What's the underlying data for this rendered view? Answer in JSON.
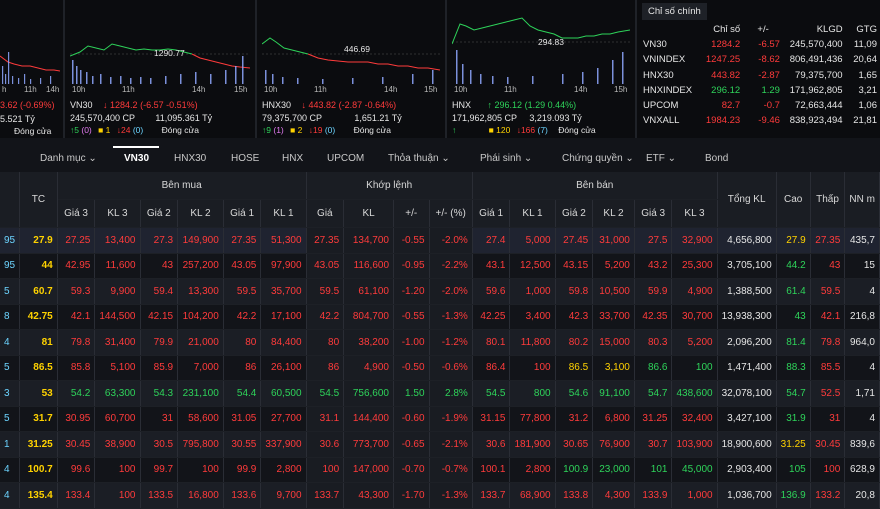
{
  "minis": [
    {
      "id": "m0",
      "peak": "",
      "times": [
        "",
        "",
        "",
        ""
      ],
      "name": "",
      "price": "",
      "change": "3.62 (-0.69%)",
      "color": "dn",
      "vol": "5.521 Tỷ",
      "up": "",
      "ce": "",
      "dn": "",
      "status": "Đóng cửa"
    },
    {
      "id": "m1",
      "peak": "1290.77",
      "times": [
        "10h",
        "11h",
        "14h",
        "15h"
      ],
      "name": "VN30",
      "price": "↓ 1284.2",
      "change": "(-6.57 -0.51%)",
      "color": "dn",
      "vol": "245,570,400 CP",
      "val": "11,095.361 Tỷ",
      "up": "↑5",
      "ce": "(0)",
      "fl": "■ 1",
      "dn": "↓24",
      "dn2": "(0)",
      "status": "Đóng cửa"
    },
    {
      "id": "m2",
      "peak": "446.69",
      "times": [
        "10h",
        "11h",
        "14h",
        "15h"
      ],
      "name": "HNX30",
      "price": "↓ 443.82",
      "change": "(-2.87 -0.64%)",
      "color": "dn",
      "vol": "79,375,700 CP",
      "val": "1,651.21 Tỷ",
      "up": "↑9",
      "ce": "(1)",
      "fl": "■ 2",
      "dn": "↓19",
      "dn2": "(0)",
      "status": "Đóng cửa"
    },
    {
      "id": "m3",
      "peak": "294.83",
      "times": [
        "10h",
        "11h",
        "14h",
        "15h"
      ],
      "name": "HNX",
      "price": "↑ 296.12",
      "change": "(1.29 0.44%)",
      "color": "up",
      "vol": "171,962,805 CP",
      "val": "3,219.093 Tỷ",
      "up": "↑",
      "ce": "",
      "fl": "■ 120",
      "dn": "↓166",
      "dn2": "(7)",
      "status": "Đóng cửa"
    }
  ],
  "index_panel": {
    "tab": "Chỉ số chính",
    "headers": [
      "Chỉ số",
      "+/-",
      "KLGD",
      "GTG"
    ],
    "rows": [
      {
        "name": "VN30",
        "value": "1284.2",
        "change": "-6.57",
        "vol": "245,570,400",
        "gtg": "11,09",
        "c": "dn"
      },
      {
        "name": "VNINDEX",
        "value": "1247.25",
        "change": "-8.62",
        "vol": "806,491,436",
        "gtg": "20,64",
        "c": "dn"
      },
      {
        "name": "HNX30",
        "value": "443.82",
        "change": "-2.87",
        "vol": "79,375,700",
        "gtg": "1,65",
        "c": "dn"
      },
      {
        "name": "HNXINDEX",
        "value": "296.12",
        "change": "1.29",
        "vol": "171,962,805",
        "gtg": "3,21",
        "c": "up"
      },
      {
        "name": "UPCOM",
        "value": "82.7",
        "change": "-0.7",
        "vol": "72,663,444",
        "gtg": "1,06",
        "c": "dn"
      },
      {
        "name": "VNXALL",
        "value": "1984.23",
        "change": "-9.46",
        "vol": "838,923,494",
        "gtg": "21,81",
        "c": "dn"
      }
    ]
  },
  "tabs": [
    "Danh mục ⌄",
    "VN30",
    "HNX30",
    "HOSE",
    "HNX",
    "UPCOM",
    "Thỏa thuận ⌄",
    "Phái sinh ⌄",
    "Chứng quyền ⌄",
    "ETF ⌄",
    "Bond"
  ],
  "groups": {
    "buy": "Bên mua",
    "match": "Khớp lệnh",
    "sell": "Bên bán"
  },
  "columns": [
    "TC",
    "Giá 3",
    "KL 3",
    "Giá 2",
    "KL 2",
    "Giá 1",
    "KL 1",
    "Giá",
    "KL",
    "+/-",
    "+/- (%)",
    "Giá 1",
    "KL 1",
    "Giá 2",
    "KL 2",
    "Giá 3",
    "KL 3",
    "Tổng KL",
    "Cao",
    "Thấp",
    "NN m"
  ],
  "rows": [
    {
      "s": "95",
      "c": [
        "27.9",
        "27.25",
        "13,400",
        "27.3",
        "149,900",
        "27.35",
        "51,300",
        "27.35",
        "134,700",
        "-0.55",
        "-2.0%",
        "27.4",
        "5,000",
        "27.45",
        "31,000",
        "27.5",
        "32,900",
        "4,656,800",
        "27.9",
        "27.35",
        "435,7"
      ],
      "k": [
        "ce",
        "dn",
        "dn",
        "dn",
        "dn",
        "dn",
        "dn",
        "dn",
        "dn",
        "dn",
        "dn",
        "dn",
        "dn",
        "dn",
        "dn",
        "dn",
        "dn",
        "wh",
        "ce",
        "dn",
        "wh"
      ]
    },
    {
      "s": "95",
      "c": [
        "44",
        "42.95",
        "11,600",
        "43",
        "257,200",
        "43.05",
        "97,900",
        "43.05",
        "116,600",
        "-0.95",
        "-2.2%",
        "43.1",
        "12,500",
        "43.15",
        "5,200",
        "43.2",
        "25,300",
        "3,705,100",
        "44.2",
        "43",
        "15"
      ],
      "k": [
        "ce",
        "dn",
        "dn",
        "dn",
        "dn",
        "dn",
        "dn",
        "dn",
        "dn",
        "dn",
        "dn",
        "dn",
        "dn",
        "dn",
        "dn",
        "dn",
        "dn",
        "wh",
        "up",
        "dn",
        "wh"
      ]
    },
    {
      "s": "5",
      "c": [
        "60.7",
        "59.3",
        "9,900",
        "59.4",
        "13,300",
        "59.5",
        "35,700",
        "59.5",
        "61,100",
        "-1.20",
        "-2.0%",
        "59.6",
        "1,000",
        "59.8",
        "10,500",
        "59.9",
        "4,900",
        "1,388,500",
        "61.4",
        "59.5",
        "4"
      ],
      "k": [
        "ce",
        "dn",
        "dn",
        "dn",
        "dn",
        "dn",
        "dn",
        "dn",
        "dn",
        "dn",
        "dn",
        "dn",
        "dn",
        "dn",
        "dn",
        "dn",
        "dn",
        "wh",
        "up",
        "dn",
        "wh"
      ]
    },
    {
      "s": "8",
      "c": [
        "42.75",
        "42.1",
        "144,500",
        "42.15",
        "104,200",
        "42.2",
        "17,100",
        "42.2",
        "804,700",
        "-0.55",
        "-1.3%",
        "42.25",
        "3,400",
        "42.3",
        "33,700",
        "42.35",
        "30,700",
        "13,938,300",
        "43",
        "42.1",
        "216,8"
      ],
      "k": [
        "ce",
        "dn",
        "dn",
        "dn",
        "dn",
        "dn",
        "dn",
        "dn",
        "dn",
        "dn",
        "dn",
        "dn",
        "dn",
        "dn",
        "dn",
        "dn",
        "dn",
        "wh",
        "up",
        "dn",
        "wh"
      ]
    },
    {
      "s": "4",
      "c": [
        "81",
        "79.8",
        "31,400",
        "79.9",
        "21,000",
        "80",
        "84,400",
        "80",
        "38,200",
        "-1.00",
        "-1.2%",
        "80.1",
        "11,800",
        "80.2",
        "15,000",
        "80.3",
        "5,200",
        "2,096,200",
        "81.4",
        "79.8",
        "964,0"
      ],
      "k": [
        "ce",
        "dn",
        "dn",
        "dn",
        "dn",
        "dn",
        "dn",
        "dn",
        "dn",
        "dn",
        "dn",
        "dn",
        "dn",
        "dn",
        "dn",
        "dn",
        "dn",
        "wh",
        "up",
        "dn",
        "wh"
      ]
    },
    {
      "s": "5",
      "c": [
        "86.5",
        "85.8",
        "5,100",
        "85.9",
        "7,000",
        "86",
        "26,100",
        "86",
        "4,900",
        "-0.50",
        "-0.6%",
        "86.4",
        "100",
        "86.5",
        "3,100",
        "86.6",
        "100",
        "1,471,400",
        "88.3",
        "85.5",
        "4"
      ],
      "k": [
        "ce",
        "dn",
        "dn",
        "dn",
        "dn",
        "dn",
        "dn",
        "dn",
        "dn",
        "dn",
        "dn",
        "dn",
        "dn",
        "ce",
        "ce",
        "up",
        "up",
        "wh",
        "up",
        "dn",
        "wh"
      ]
    },
    {
      "s": "3",
      "c": [
        "53",
        "54.2",
        "63,300",
        "54.3",
        "231,100",
        "54.4",
        "60,500",
        "54.5",
        "756,600",
        "1.50",
        "2.8%",
        "54.5",
        "800",
        "54.6",
        "91,100",
        "54.7",
        "438,600",
        "32,078,100",
        "54.7",
        "52.5",
        "1,71"
      ],
      "k": [
        "ce",
        "up",
        "up",
        "up",
        "up",
        "up",
        "up",
        "up",
        "up",
        "up",
        "up",
        "up",
        "up",
        "up",
        "up",
        "up",
        "up",
        "wh",
        "up",
        "dn",
        "wh"
      ]
    },
    {
      "s": "5",
      "c": [
        "31.7",
        "30.95",
        "60,700",
        "31",
        "58,600",
        "31.05",
        "27,700",
        "31.1",
        "144,400",
        "-0.60",
        "-1.9%",
        "31.15",
        "77,800",
        "31.2",
        "6,800",
        "31.25",
        "32,400",
        "3,427,100",
        "31.9",
        "31",
        "4"
      ],
      "k": [
        "ce",
        "dn",
        "dn",
        "dn",
        "dn",
        "dn",
        "dn",
        "dn",
        "dn",
        "dn",
        "dn",
        "dn",
        "dn",
        "dn",
        "dn",
        "dn",
        "dn",
        "wh",
        "up",
        "dn",
        "wh"
      ]
    },
    {
      "s": "1",
      "c": [
        "31.25",
        "30.45",
        "38,900",
        "30.5",
        "795,800",
        "30.55",
        "337,900",
        "30.6",
        "773,700",
        "-0.65",
        "-2.1%",
        "30.6",
        "181,900",
        "30.65",
        "76,900",
        "30.7",
        "103,900",
        "18,900,600",
        "31.25",
        "30.45",
        "839,6"
      ],
      "k": [
        "ce",
        "dn",
        "dn",
        "dn",
        "dn",
        "dn",
        "dn",
        "dn",
        "dn",
        "dn",
        "dn",
        "dn",
        "dn",
        "dn",
        "dn",
        "dn",
        "dn",
        "wh",
        "ce",
        "dn",
        "wh"
      ]
    },
    {
      "s": "4",
      "c": [
        "100.7",
        "99.6",
        "100",
        "99.7",
        "100",
        "99.9",
        "2,800",
        "100",
        "147,000",
        "-0.70",
        "-0.7%",
        "100.1",
        "2,800",
        "100.9",
        "23,000",
        "101",
        "45,000",
        "2,903,400",
        "105",
        "100",
        "628,9"
      ],
      "k": [
        "ce",
        "dn",
        "dn",
        "dn",
        "dn",
        "dn",
        "dn",
        "dn",
        "dn",
        "dn",
        "dn",
        "dn",
        "dn",
        "up",
        "up",
        "up",
        "up",
        "wh",
        "up",
        "dn",
        "wh"
      ]
    },
    {
      "s": "4",
      "c": [
        "135.4",
        "133.4",
        "100",
        "133.5",
        "16,800",
        "133.6",
        "9,700",
        "133.7",
        "43,300",
        "-1.70",
        "-1.3%",
        "133.7",
        "68,900",
        "133.8",
        "4,300",
        "133.9",
        "1,000",
        "1,036,700",
        "136.9",
        "133.2",
        "20,8"
      ],
      "k": [
        "ce",
        "dn",
        "dn",
        "dn",
        "dn",
        "dn",
        "dn",
        "dn",
        "dn",
        "dn",
        "dn",
        "dn",
        "dn",
        "dn",
        "dn",
        "dn",
        "dn",
        "wh",
        "up",
        "dn",
        "wh"
      ]
    }
  ],
  "colors": {
    "up": "#2ed35a",
    "down": "#ff3b3b",
    "ref": "#ffd200",
    "bg": "#121419"
  }
}
